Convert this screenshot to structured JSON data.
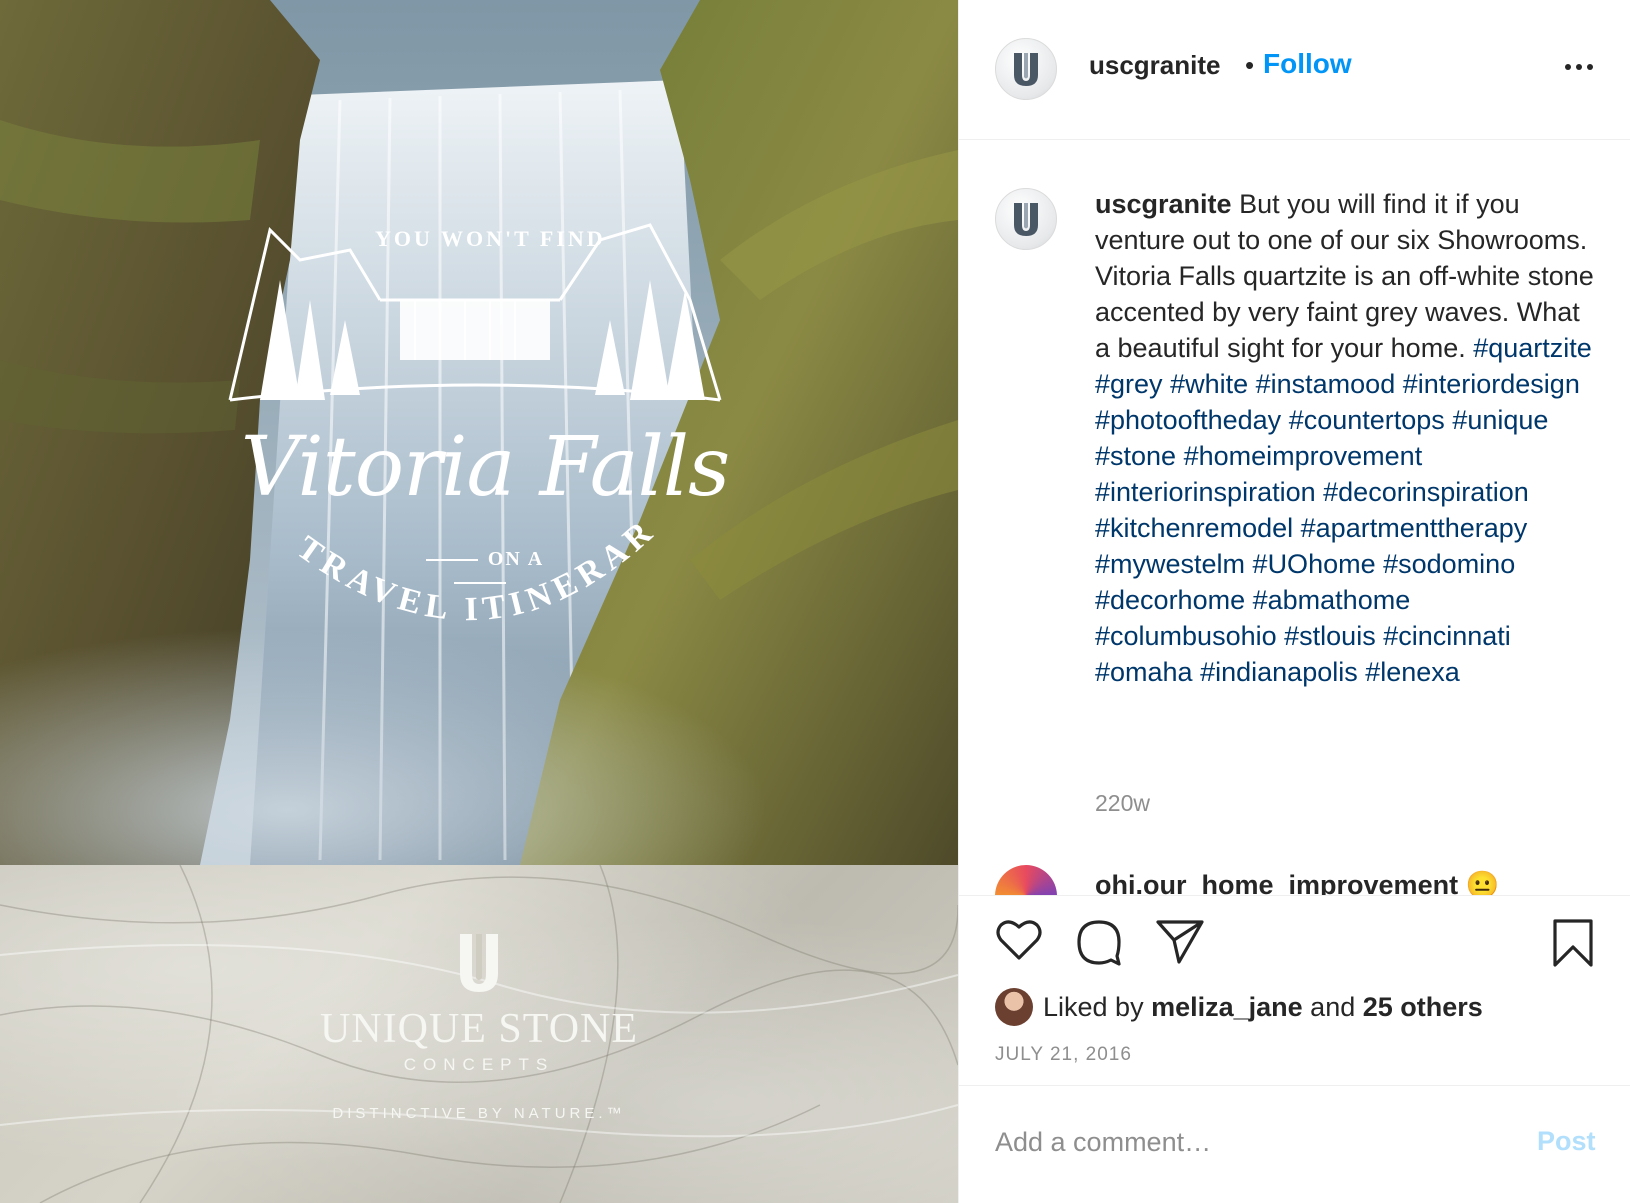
{
  "post": {
    "username": "uscgranite",
    "follow_label": "Follow",
    "separator": "•",
    "more_icon": "more-options-icon"
  },
  "media": {
    "overlay": {
      "top_line": "YOU WON'T FIND",
      "title": "Vitoria Falls",
      "on_a": "ON A",
      "bottom_line": "TRAVEL ITINERARY"
    },
    "brand": {
      "name": "UNIQUE STONE",
      "sub": "CONCEPTS",
      "tagline": "DISTINCTIVE BY NATURE.™"
    }
  },
  "caption": {
    "username": "uscgranite",
    "text": "But you will find it if you venture out to one of our six Showrooms. Vitoria Falls quartzite is an off-white stone accented by very faint grey waves. What a beautiful sight for your home.",
    "hashtags": [
      "#quartzite",
      "#grey",
      "#white",
      "#instamood",
      "#interiordesign",
      "#photooftheday",
      "#countertops",
      "#unique",
      "#stone",
      "#homeimprovement",
      "#interiorinspiration",
      "#decorinspiration",
      "#kitchenremodel",
      "#apartmenttherapy",
      "#mywestelm",
      "#UOhome",
      "#sodomino",
      "#decorhome",
      "#abmathome",
      "#columbusohio",
      "#stlouis",
      "#cincinnati",
      "#omaha",
      "#indianapolis",
      "#lenexa"
    ],
    "time_ago": "220w"
  },
  "partial_comment": {
    "text": "ohi.our_home_improvement 😐"
  },
  "actions": {
    "icons": [
      "heart-icon",
      "comment-icon",
      "share-icon",
      "bookmark-icon"
    ],
    "liked_prefix": "Liked by ",
    "liked_user": "meliza_jane",
    "liked_middle": " and ",
    "liked_others": "25 others",
    "date": "JULY 21, 2016"
  },
  "comment_box": {
    "placeholder": "Add a comment…",
    "post_label": "Post"
  },
  "colors": {
    "link_blue": "#0095f6",
    "hashtag_blue": "#00376b",
    "muted_gray": "#8e8e8e",
    "post_disabled": "#b2dffc"
  }
}
